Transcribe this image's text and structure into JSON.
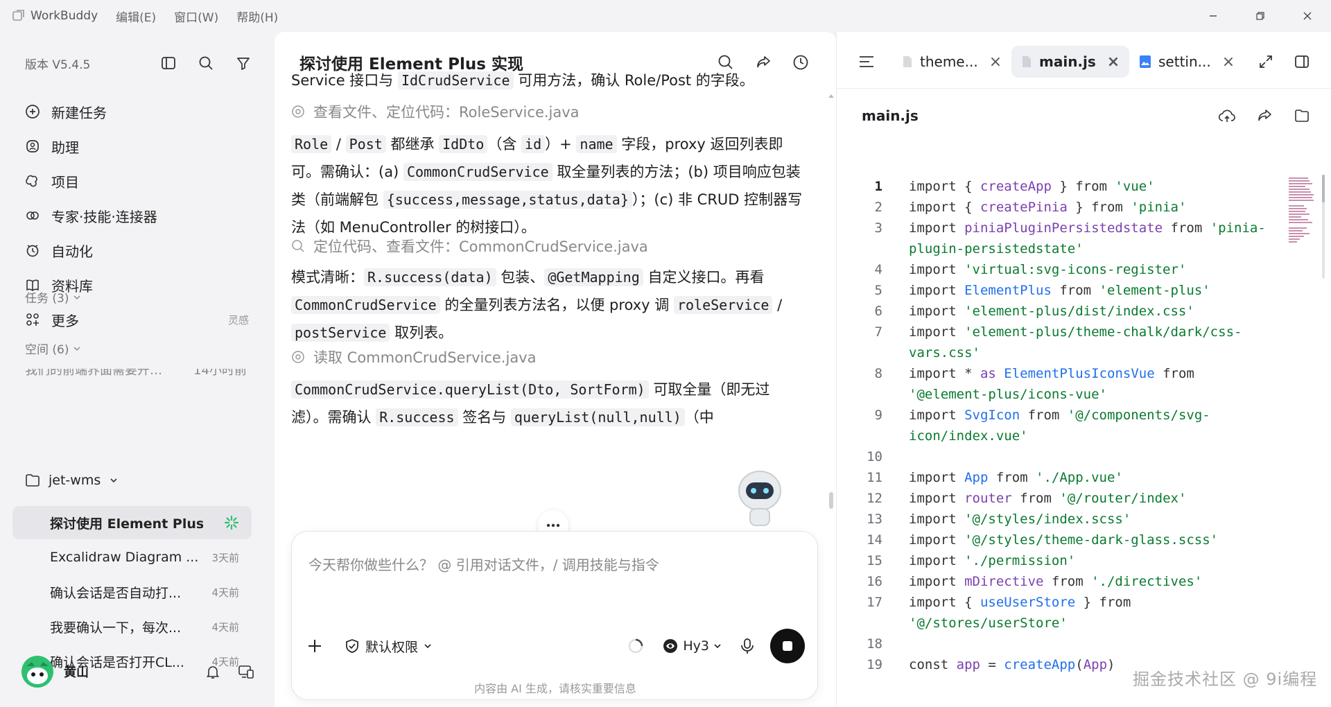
{
  "titlebar": {
    "app_name": "WorkBuddy",
    "menus": [
      "编辑(E)",
      "窗口(W)",
      "帮助(H)"
    ]
  },
  "sidebar": {
    "version": "版本 V5.4.5",
    "nav": [
      {
        "label": "新建任务",
        "icon": "new-task-icon"
      },
      {
        "label": "助理",
        "icon": "assistant-icon"
      },
      {
        "label": "项目",
        "icon": "project-icon"
      },
      {
        "label": "专家·技能·连接器",
        "icon": "expert-icon"
      },
      {
        "label": "自动化",
        "icon": "automation-icon"
      },
      {
        "label": "资料库",
        "icon": "library-icon"
      },
      {
        "label": "更多",
        "icon": "more-icon",
        "tail": "灵感"
      }
    ],
    "tasks_label": "任务 (3)",
    "task_clipped": {
      "title": "我们的前端界面需要开…",
      "time": "14小时前"
    },
    "spaces_label": "空间 (6)",
    "project_name": "jet-wms",
    "sessions": [
      {
        "title": "探讨使用 Element Plus...",
        "time": ""
      },
      {
        "title": "Excalidraw Diagram ...",
        "time": "3天前"
      },
      {
        "title": "确认会话是否自动打...",
        "time": "4天前"
      },
      {
        "title": "我要确认一下，每次...",
        "time": "4天前"
      },
      {
        "title": "确认会话是否打开CL...",
        "time": "4天前"
      }
    ],
    "user_name": "黄山"
  },
  "chat": {
    "title": "探讨使用 Element Plus 实现",
    "msg1": {
      "t1": "Service 接口与 ",
      "c1": "IdCrudService",
      "t2": " 可用方法，确认 Role/Post 的字段。"
    },
    "step1": "查看文件、定位代码：RoleService.java",
    "msg2": {
      "c1": "Role",
      "t1": " / ",
      "c2": "Post",
      "t2": " 都继承 ",
      "c3": "IdDto",
      "t3": "（含 ",
      "c4": "id",
      "t4": "）+ ",
      "c5": "name",
      "t5": " 字段，proxy 返回列表即可。需确认：(a) ",
      "c6": "CommonCrudService",
      "t6": " 取全量列表的方法；(b) 项目响应包装类（前端解包 ",
      "c7": "{success,message,status,data}",
      "t7": "）；(c) 非 CRUD 控制器写法（如 MenuController 的树接口）。"
    },
    "step2": "定位代码、查看文件：CommonCrudService.java",
    "msg3": {
      "t1": "模式清晰：",
      "c1": "R.success(data)",
      "t2": " 包装、",
      "c2": "@GetMapping",
      "t3": " 自定义接口。再看 ",
      "c3": "CommonCrudService",
      "t4": " 的全量列表方法名，以便 proxy 调 ",
      "c4": "roleService",
      "t5": " / ",
      "c5": "postService",
      "t6": " 取列表。"
    },
    "step3": "读取 CommonCrudService.java",
    "msg4": {
      "c1": "CommonCrudService.queryList(Dto, SortForm)",
      "t1": " 可取全量（",
      "t1b": "即无过滤）。需确认 ",
      "c2": "R.success",
      "t2": " 签名与 ",
      "c3": "queryList(null,null)",
      "t3": "（中"
    },
    "composer_placeholder": "今天帮你做些什么？ @ 引用对话文件，/ 调用技能与指令",
    "permission_label": "默认权限",
    "model_label": "Hy3",
    "footnote": "内容由 AI 生成，请核实重要信息"
  },
  "editor": {
    "tabs": [
      {
        "label": "theme...",
        "active": false
      },
      {
        "label": "main.js",
        "active": true
      },
      {
        "label": "settin...",
        "active": false
      }
    ],
    "file_name": "main.js",
    "current_line": 1,
    "lines": [
      {
        "n": 1,
        "parts": [
          [
            "k",
            "import { "
          ],
          [
            "v",
            "createApp"
          ],
          [
            "k",
            " } from "
          ],
          [
            "s",
            "'vue'"
          ]
        ]
      },
      {
        "n": 2,
        "parts": [
          [
            "k",
            "import { "
          ],
          [
            "v",
            "createPinia"
          ],
          [
            "k",
            " } from "
          ],
          [
            "s",
            "'pinia'"
          ]
        ]
      },
      {
        "n": 3,
        "parts": [
          [
            "k",
            "import "
          ],
          [
            "v",
            "piniaPluginPersistedstate"
          ],
          [
            "k",
            " from "
          ],
          [
            "s",
            "'pinia-plugin-persistedstate'"
          ]
        ]
      },
      {
        "n": 4,
        "parts": [
          [
            "k",
            "import "
          ],
          [
            "s",
            "'virtual:svg-icons-register'"
          ]
        ]
      },
      {
        "n": 5,
        "parts": [
          [
            "k",
            "import "
          ],
          [
            "b",
            "ElementPlus"
          ],
          [
            "k",
            " from "
          ],
          [
            "s",
            "'element-plus'"
          ]
        ]
      },
      {
        "n": 6,
        "parts": [
          [
            "k",
            "import "
          ],
          [
            "s",
            "'element-plus/dist/index.css'"
          ]
        ]
      },
      {
        "n": 7,
        "parts": [
          [
            "k",
            "import "
          ],
          [
            "s",
            "'element-plus/theme-chalk/dark/css-vars.css'"
          ]
        ]
      },
      {
        "n": 8,
        "parts": [
          [
            "k",
            "import * "
          ],
          [
            "v",
            "as"
          ],
          [
            "k",
            " "
          ],
          [
            "b",
            "ElementPlusIconsVue"
          ],
          [
            "k",
            " from "
          ],
          [
            "s",
            "'@element-plus/icons-vue'"
          ]
        ]
      },
      {
        "n": 9,
        "parts": [
          [
            "k",
            "import "
          ],
          [
            "b",
            "SvgIcon"
          ],
          [
            "k",
            " from "
          ],
          [
            "s",
            "'@/components/svg-icon/index.vue'"
          ]
        ]
      },
      {
        "n": 10,
        "parts": [
          [
            "k",
            ""
          ]
        ]
      },
      {
        "n": 11,
        "parts": [
          [
            "k",
            "import "
          ],
          [
            "b",
            "App"
          ],
          [
            "k",
            " from "
          ],
          [
            "s",
            "'./App.vue'"
          ]
        ]
      },
      {
        "n": 12,
        "parts": [
          [
            "k",
            "import "
          ],
          [
            "v",
            "router"
          ],
          [
            "k",
            " from "
          ],
          [
            "s",
            "'@/router/index'"
          ]
        ]
      },
      {
        "n": 13,
        "parts": [
          [
            "k",
            "import "
          ],
          [
            "s",
            "'@/styles/index.scss'"
          ]
        ]
      },
      {
        "n": 14,
        "parts": [
          [
            "k",
            "import "
          ],
          [
            "s",
            "'@/styles/theme-dark-glass.scss'"
          ]
        ]
      },
      {
        "n": 15,
        "parts": [
          [
            "k",
            "import "
          ],
          [
            "s",
            "'./permission'"
          ]
        ]
      },
      {
        "n": 16,
        "parts": [
          [
            "k",
            "import "
          ],
          [
            "v",
            "mDirective"
          ],
          [
            "k",
            " from "
          ],
          [
            "s",
            "'./directives'"
          ]
        ]
      },
      {
        "n": 17,
        "parts": [
          [
            "k",
            "import { "
          ],
          [
            "b",
            "useUserStore"
          ],
          [
            "k",
            " } from "
          ],
          [
            "s",
            "'@/stores/userStore'"
          ]
        ]
      },
      {
        "n": 18,
        "parts": [
          [
            "k",
            ""
          ]
        ]
      },
      {
        "n": 19,
        "parts": [
          [
            "k",
            "const "
          ],
          [
            "v",
            "app"
          ],
          [
            "k",
            " = "
          ],
          [
            "b",
            "createApp"
          ],
          [
            "k",
            "("
          ],
          [
            "v",
            "App"
          ],
          [
            "k",
            ")"
          ]
        ]
      }
    ]
  },
  "watermark": "掘金技术社区 @ 9i编程",
  "colors": {
    "accent_green": "#2fbf71",
    "keyword_purple": "#7b3fb0",
    "keyword_blue": "#1f6feb",
    "string_green": "#0a7a2f"
  }
}
